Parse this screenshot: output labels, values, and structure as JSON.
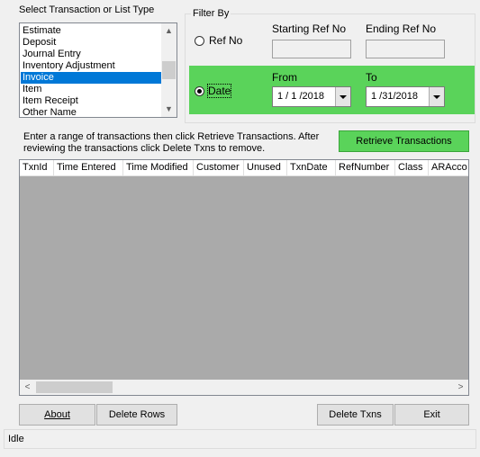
{
  "list_section": {
    "title": "Select Transaction or List Type",
    "items": [
      "Estimate",
      "Deposit",
      "Journal Entry",
      "Inventory Adjustment",
      "Invoice",
      "Item",
      "Item Receipt",
      "Other Name"
    ],
    "selected": "Invoice"
  },
  "filter": {
    "title": "Filter By",
    "ref_no_label": "Ref No",
    "starting_ref_label": "Starting Ref No",
    "ending_ref_label": "Ending Ref No",
    "starting_ref_value": "",
    "ending_ref_value": "",
    "date_label": "Date",
    "from_label": "From",
    "to_label": "To",
    "from_value": "1 / 1 /2018",
    "to_value": "1 /31/2018",
    "selected_mode": "Date"
  },
  "instructions": {
    "line1": "Enter a range of transactions then click Retrieve Transactions. After",
    "line2": "reviewing the transactions click Delete Txns to remove."
  },
  "retrieve_button": "Retrieve Transactions",
  "grid": {
    "columns": [
      "TxnId",
      "Time Entered",
      "Time Modified",
      "Customer",
      "Unused",
      "TxnDate",
      "RefNumber",
      "Class",
      "ARAcco"
    ]
  },
  "buttons": {
    "about": "About",
    "delete_rows": "Delete Rows",
    "delete_txns": "Delete Txns",
    "exit": "Exit"
  },
  "status": "Idle",
  "colors": {
    "accent_green": "#5ad35a",
    "selection_blue": "#0078d7",
    "grid_background": "#aaaaaa"
  }
}
